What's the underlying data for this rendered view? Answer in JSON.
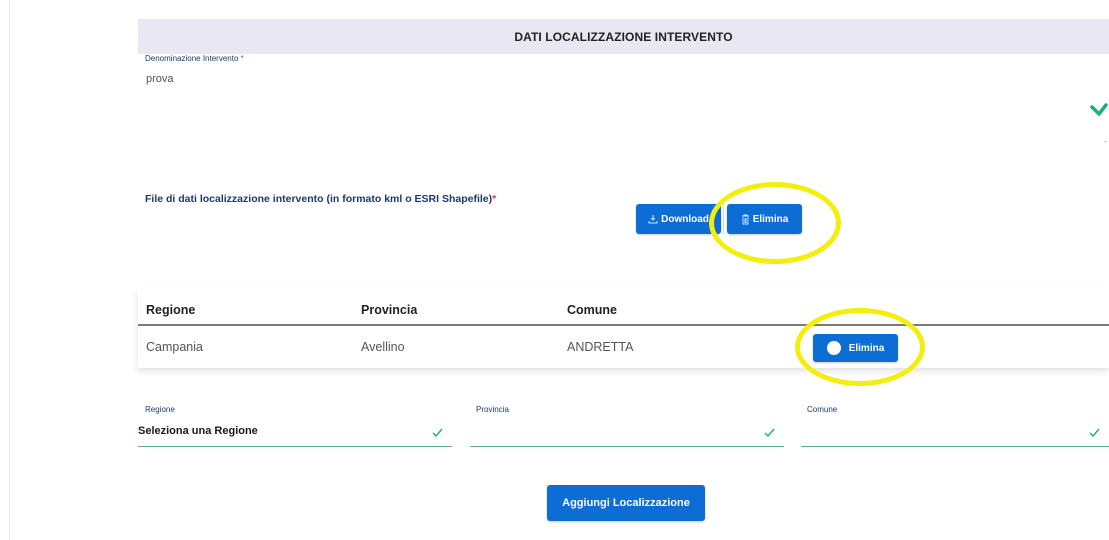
{
  "section": {
    "title": "DATI LOCALIZZAZIONE INTERVENTO"
  },
  "name_field": {
    "label": "Denominazione Intervento",
    "required_mark": "*",
    "value": "prova"
  },
  "file_section": {
    "label": "File di dati localizzazione intervento (in formato kml o ESRI Shapefile)",
    "required_mark": "*",
    "download_label": "Download",
    "delete_label": "Elimina"
  },
  "table": {
    "headers": [
      "Regione",
      "Provincia",
      "Comune"
    ],
    "rows": [
      {
        "regione": "Campania",
        "provincia": "Avellino",
        "comune": "ANDRETTA",
        "action_label": "Elimina"
      }
    ]
  },
  "selectors": {
    "regione": {
      "label": "Regione",
      "value": "Seleziona una Regione"
    },
    "provincia": {
      "label": "Provincia",
      "value": ""
    },
    "comune": {
      "label": "Comune",
      "value": ""
    }
  },
  "add_button": {
    "label": "Aggiungi Localizzazione"
  },
  "colors": {
    "primary": "#0c6dd4",
    "highlight": "#f3ee0b",
    "valid": "#1fae7a",
    "header_bg": "#e9e8f2"
  },
  "icons": [
    "check-icon",
    "download-icon",
    "trash-icon",
    "toggle-dot-icon"
  ]
}
